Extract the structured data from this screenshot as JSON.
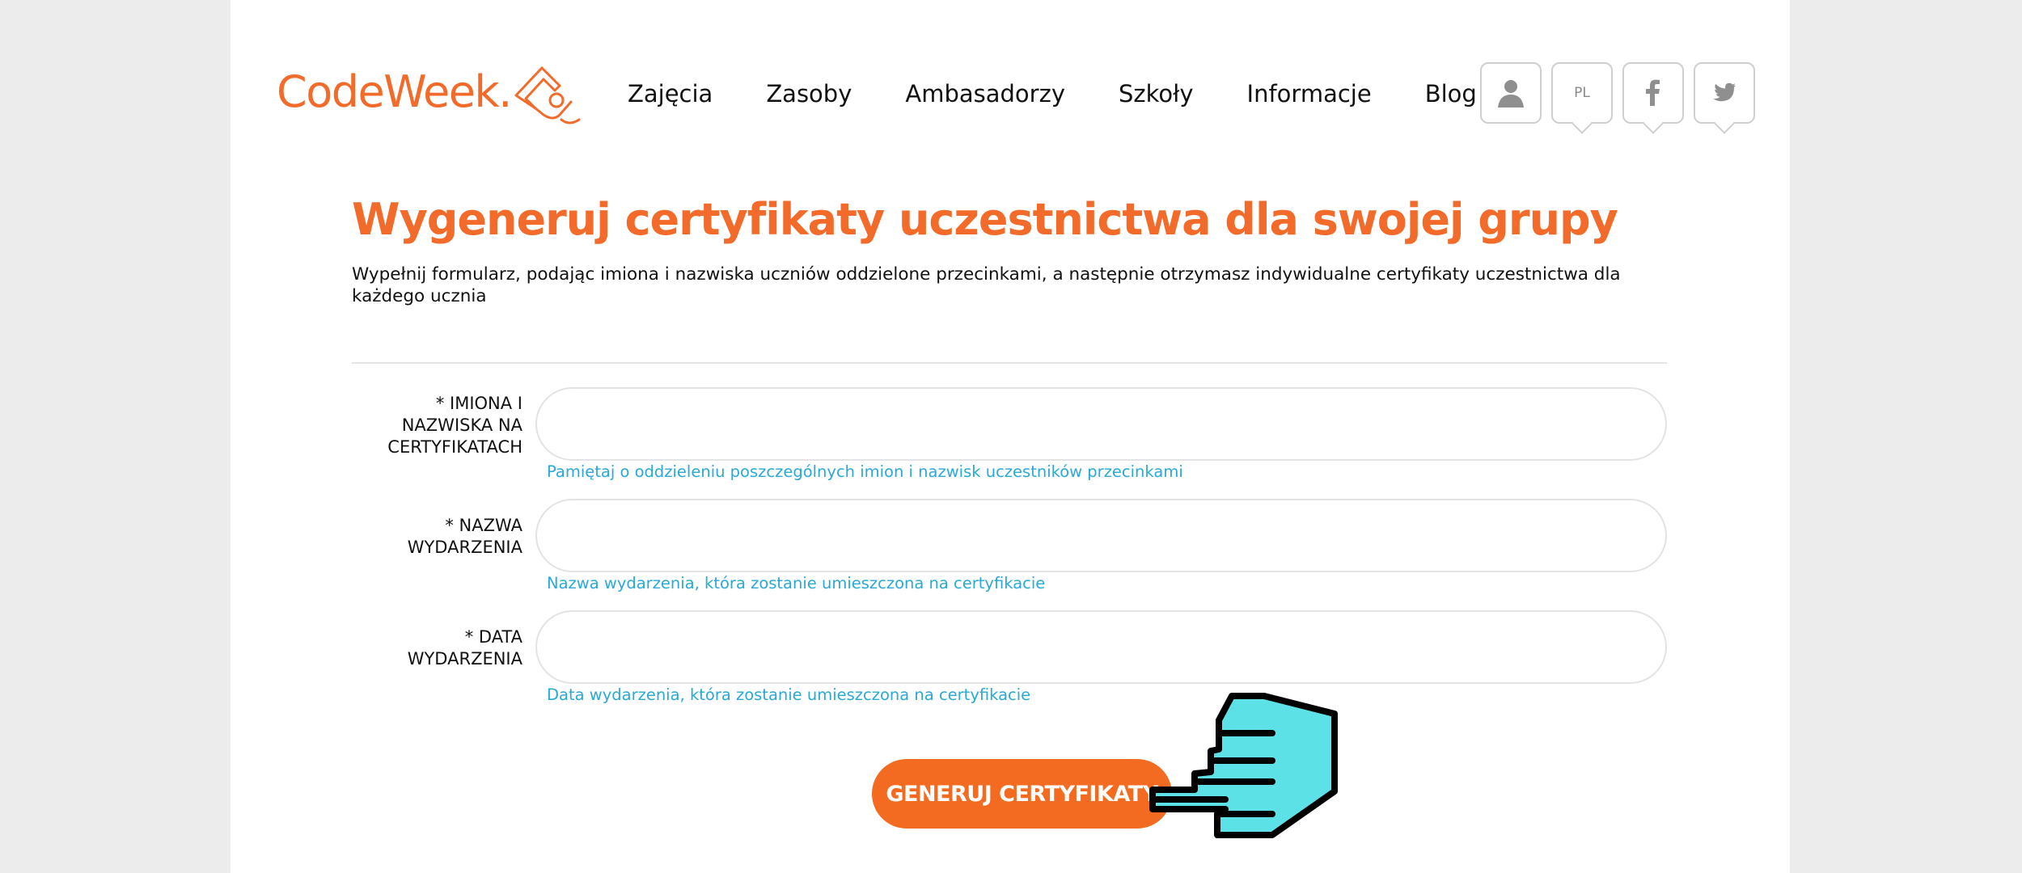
{
  "header": {
    "logo_text": "CodeWeek.",
    "nav": [
      "Zajęcia",
      "Zasoby",
      "Ambasadorzy",
      "Szkoły",
      "Informacje",
      "Blog"
    ],
    "user_icon": "user-icon",
    "language": "PL",
    "facebook_icon": "facebook-icon",
    "twitter_icon": "twitter-icon"
  },
  "main": {
    "title": "Wygeneruj certyfikaty uczestnictwa dla swojej grupy",
    "description": "Wypełnij formularz, podając imiona i nazwiska uczniów oddzielone przecinkami, a następnie otrzymasz indywidualne certyfikaty uczestnictwa dla każdego ucznia",
    "form": {
      "names": {
        "label_lines": [
          "* IMIONA I",
          "NAZWISKA NA",
          "CERTYFIKATACH"
        ],
        "value": "",
        "hint": "Pamiętaj o oddzieleniu poszczególnych imion i nazwisk uczestników przecinkami"
      },
      "event_name": {
        "label_lines": [
          "* NAZWA",
          "WYDARZENIA"
        ],
        "value": "",
        "hint": "Nazwa wydarzenia, która zostanie umieszczona na certyfikacie"
      },
      "event_date": {
        "label_lines": [
          "* DATA",
          "WYDARZENIA"
        ],
        "value": "",
        "hint": "Data wydarzenia, która zostanie umieszczona na certyfikacie"
      },
      "submit_label": "GENERUJ CERTYFIKATY"
    }
  },
  "colors": {
    "brand_orange": "#f26b2a",
    "hint_blue": "#2aa9d6",
    "pointer_cyan": "#5ce1e6"
  },
  "overlay": {
    "pointer_icon": "pointing-hand-icon"
  }
}
